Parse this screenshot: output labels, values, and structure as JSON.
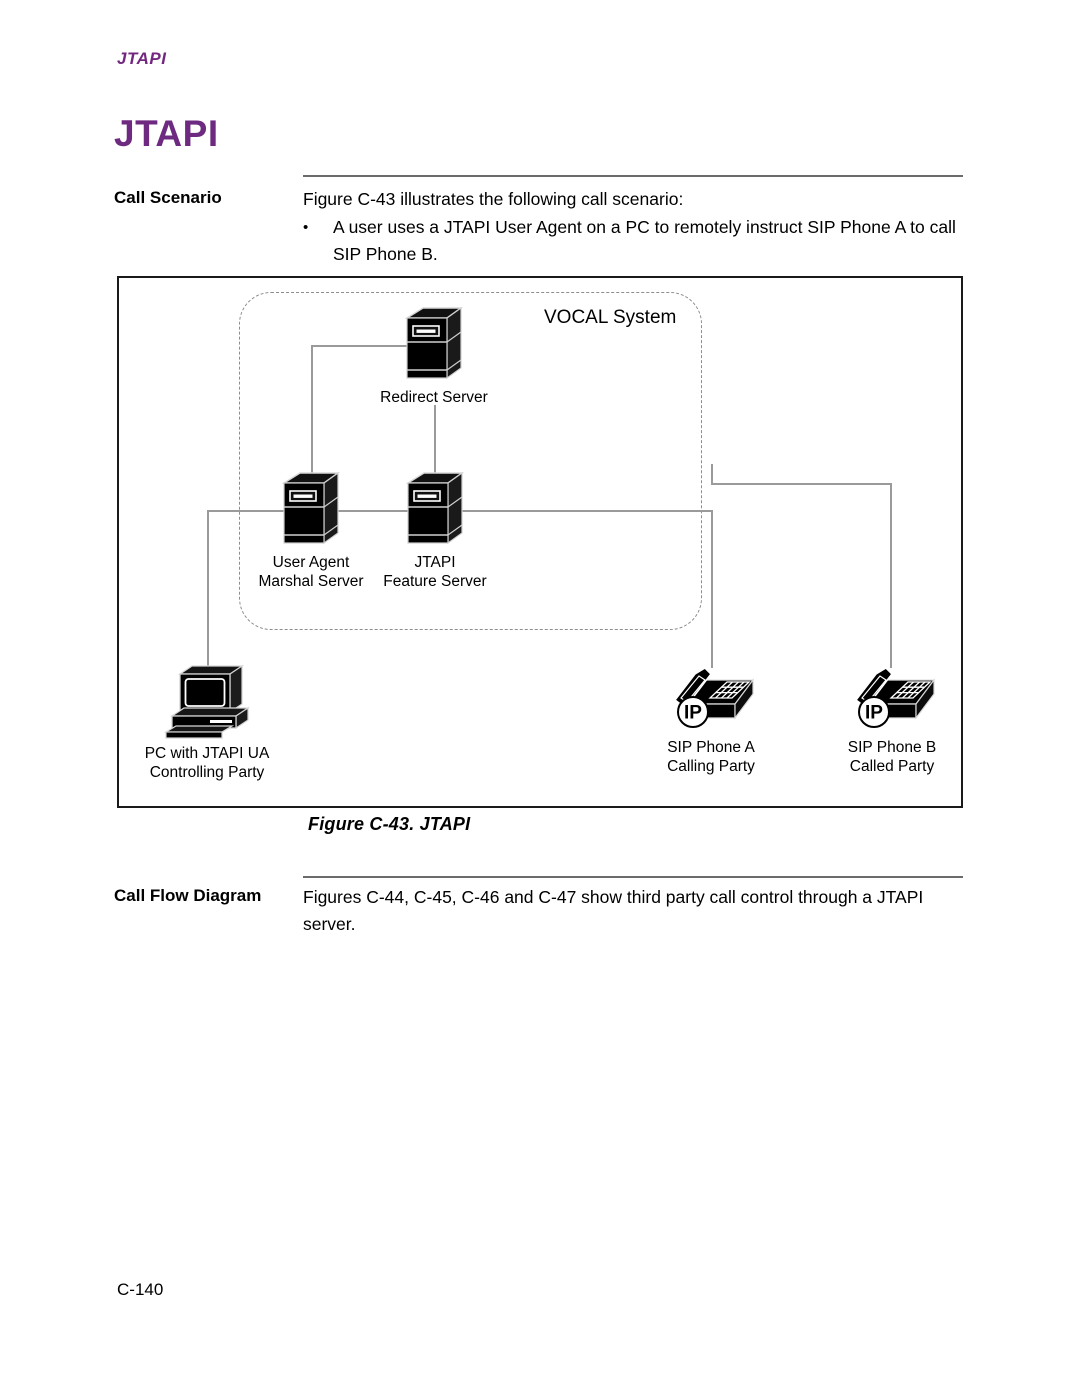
{
  "running_head": "JTAPI",
  "page_title": "JTAPI",
  "sections": {
    "call_scenario": {
      "label": "Call Scenario",
      "intro": "Figure C-43 illustrates the following call scenario:",
      "bullet_mark": "•",
      "bullets": [
        "A user uses a JTAPI User Agent on a PC to remotely instruct SIP Phone A to call SIP Phone B."
      ]
    },
    "call_flow": {
      "label": "Call Flow Diagram",
      "text": "Figures C-44, C-45, C-46 and C-47 show third party call control through a JTAPI server."
    }
  },
  "figure": {
    "caption": "Figure C-43. JTAPI",
    "boundary_label": "VOCAL System",
    "nodes": [
      {
        "id": "redirect-server",
        "icon": "server-tower-icon",
        "caption_lines": [
          "Redirect Server"
        ]
      },
      {
        "id": "user-agent-marshal-server",
        "icon": "server-tower-icon",
        "caption_lines": [
          "User Agent",
          "Marshal Server"
        ]
      },
      {
        "id": "jtapi-feature-server",
        "icon": "server-tower-icon",
        "caption_lines": [
          "JTAPI",
          "Feature Server"
        ]
      },
      {
        "id": "pc-jtapi-ua",
        "icon": "desktop-computer-icon",
        "caption_lines": [
          "PC with JTAPI UA",
          "Controlling Party"
        ]
      },
      {
        "id": "sip-phone-a",
        "icon": "ip-phone-icon",
        "badge": "IP",
        "caption_lines": [
          "SIP Phone A",
          "Calling Party"
        ]
      },
      {
        "id": "sip-phone-b",
        "icon": "ip-phone-icon",
        "badge": "IP",
        "caption_lines": [
          "SIP Phone B",
          "Called Party"
        ]
      }
    ]
  },
  "footer": {
    "page_number": "C-140"
  },
  "colors": {
    "heading_purple": "#6d2a80",
    "rule_gray": "#6b6b6b",
    "wire_gray": "#9a9a9a",
    "boundary_gray": "#8d8d8d",
    "icon_black": "#000000"
  }
}
